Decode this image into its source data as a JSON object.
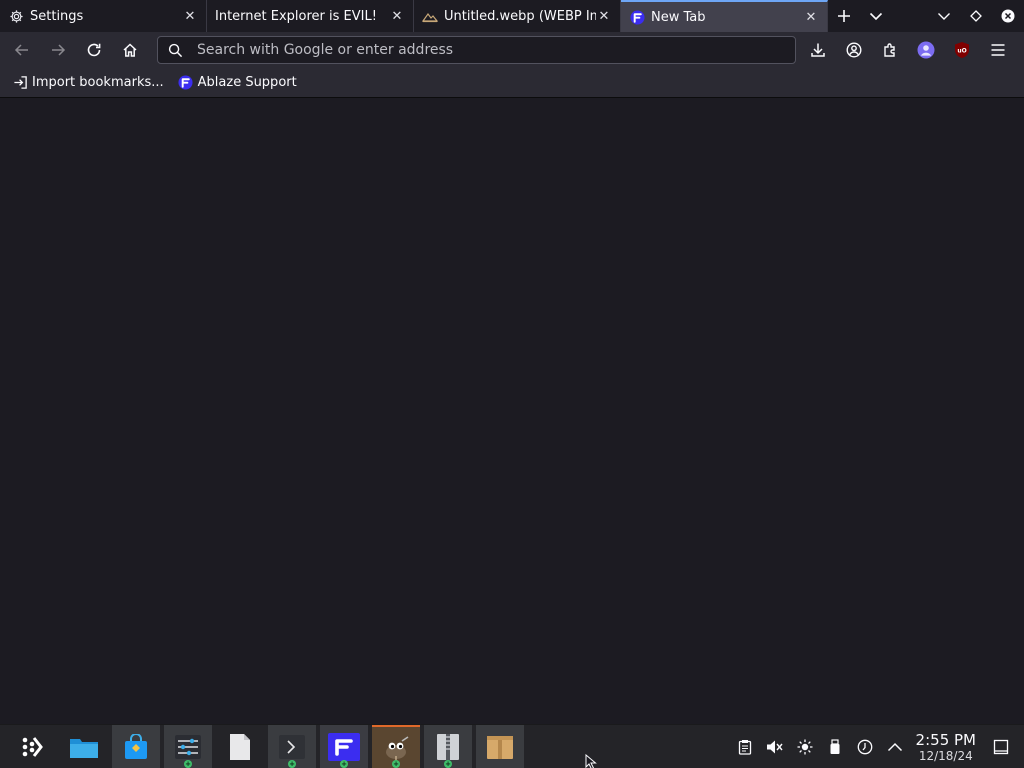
{
  "tabs": [
    {
      "title": "Settings",
      "icon": "gear-icon",
      "active": false
    },
    {
      "title": "Internet Explorer is EVIL!",
      "icon": "none",
      "active": false
    },
    {
      "title": "Untitled.webp (WEBP Im",
      "icon": "image-icon",
      "active": false
    },
    {
      "title": "New Tab",
      "icon": "floorp-icon",
      "active": true
    }
  ],
  "urlbar": {
    "placeholder": "Search with Google or enter address",
    "value": ""
  },
  "bookmarks": [
    {
      "label": "Import bookmarks...",
      "icon": "import-icon"
    },
    {
      "label": "Ablaze Support",
      "icon": "floorp-icon"
    }
  ],
  "taskbar": {
    "apps": [
      "app-launcher-icon",
      "file-manager-icon",
      "discover-store-icon",
      "system-settings-icon",
      "text-file-icon",
      "terminal-icon",
      "floorp-browser-icon",
      "gimp-icon",
      "archive-manager-icon",
      "package-icon"
    ],
    "clock": {
      "time": "2:55 PM",
      "date": "12/18/24"
    }
  },
  "colors": {
    "accent": "#6ea6f5",
    "floorp": "#3b2df0",
    "ublock": "#800000",
    "running_indicator": "#3fbf6a"
  }
}
